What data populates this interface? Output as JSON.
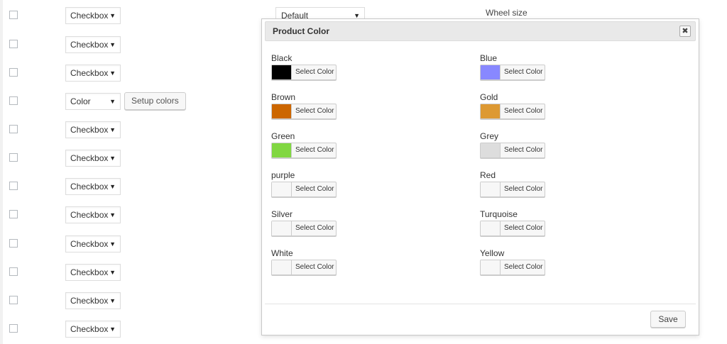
{
  "background": {
    "rows": [
      {
        "type": "Checkbox"
      },
      {
        "type": "Checkbox"
      },
      {
        "type": "Checkbox"
      },
      {
        "type": "Color",
        "setup_button": "Setup colors"
      },
      {
        "type": "Checkbox"
      },
      {
        "type": "Checkbox"
      },
      {
        "type": "Checkbox"
      },
      {
        "type": "Checkbox"
      },
      {
        "type": "Checkbox"
      },
      {
        "type": "Checkbox"
      },
      {
        "type": "Checkbox"
      },
      {
        "type": "Checkbox"
      }
    ],
    "default_select": "Default",
    "wheel_label": "Wheel size"
  },
  "modal": {
    "title": "Product Color",
    "close_icon": "close-icon",
    "picker_label": "Select Color",
    "colors": [
      {
        "name": "Black",
        "swatch": "#000000"
      },
      {
        "name": "Blue",
        "swatch": "#8888ff"
      },
      {
        "name": "Brown",
        "swatch": "#cc6600"
      },
      {
        "name": "Gold",
        "swatch": "#dd9933"
      },
      {
        "name": "Green",
        "swatch": "#81d742"
      },
      {
        "name": "Grey",
        "swatch": "#dddddd"
      },
      {
        "name": "purple",
        "swatch": "#f7f7f7"
      },
      {
        "name": "Red",
        "swatch": "#f7f7f7"
      },
      {
        "name": "Silver",
        "swatch": "#f7f7f7"
      },
      {
        "name": "Turquoise",
        "swatch": "#f7f7f7"
      },
      {
        "name": "White",
        "swatch": "#f7f7f7"
      },
      {
        "name": "Yellow",
        "swatch": "#f7f7f7"
      }
    ],
    "save_label": "Save"
  }
}
